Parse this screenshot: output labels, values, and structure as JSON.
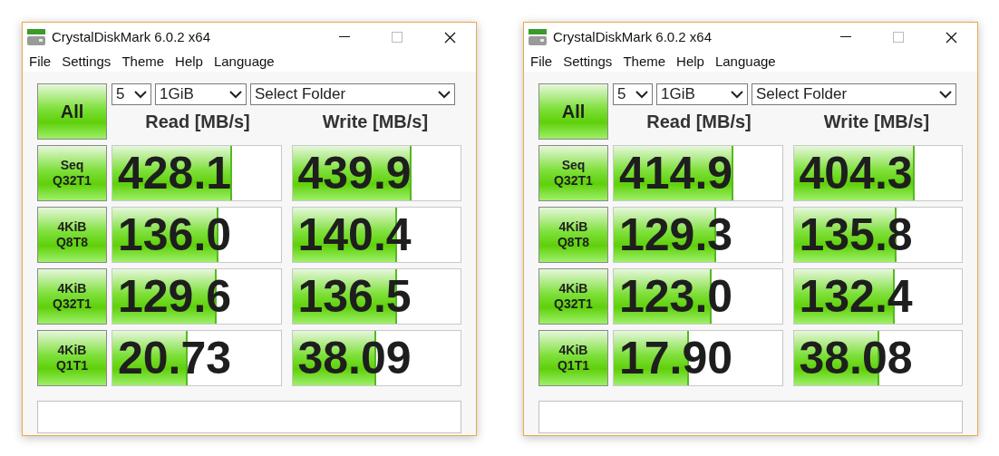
{
  "windows": [
    {
      "title": "CrystalDiskMark 6.0.2 x64",
      "menu": [
        "File",
        "Settings",
        "Theme",
        "Help",
        "Language"
      ],
      "all_button": "All",
      "count": "5",
      "size": "1GiB",
      "folder": "Select Folder",
      "read_header": "Read [MB/s]",
      "write_header": "Write [MB/s]",
      "rows": [
        {
          "test": [
            "Seq",
            "Q32T1"
          ],
          "read": {
            "value": "428.1",
            "level": 0.71
          },
          "write": {
            "value": "439.9",
            "level": 0.71
          }
        },
        {
          "test": [
            "4KiB",
            "Q8T8"
          ],
          "read": {
            "value": "136.0",
            "level": 0.63
          },
          "write": {
            "value": "140.4",
            "level": 0.62
          }
        },
        {
          "test": [
            "4KiB",
            "Q32T1"
          ],
          "read": {
            "value": "129.6",
            "level": 0.62
          },
          "write": {
            "value": "136.5",
            "level": 0.62
          }
        },
        {
          "test": [
            "4KiB",
            "Q1T1"
          ],
          "read": {
            "value": "20.73",
            "level": 0.45
          },
          "write": {
            "value": "38.09",
            "level": 0.5
          }
        }
      ]
    },
    {
      "title": "CrystalDiskMark 6.0.2 x64",
      "menu": [
        "File",
        "Settings",
        "Theme",
        "Help",
        "Language"
      ],
      "all_button": "All",
      "count": "5",
      "size": "1GiB",
      "folder": "Select Folder",
      "read_header": "Read [MB/s]",
      "write_header": "Write [MB/s]",
      "rows": [
        {
          "test": [
            "Seq",
            "Q32T1"
          ],
          "read": {
            "value": "414.9",
            "level": 0.71
          },
          "write": {
            "value": "404.3",
            "level": 0.72
          }
        },
        {
          "test": [
            "4KiB",
            "Q8T8"
          ],
          "read": {
            "value": "129.3",
            "level": 0.61
          },
          "write": {
            "value": "135.8",
            "level": 0.61
          }
        },
        {
          "test": [
            "4KiB",
            "Q32T1"
          ],
          "read": {
            "value": "123.0",
            "level": 0.58
          },
          "write": {
            "value": "132.4",
            "level": 0.6
          }
        },
        {
          "test": [
            "4KiB",
            "Q1T1"
          ],
          "read": {
            "value": "17.90",
            "level": 0.45
          },
          "write": {
            "value": "38.08",
            "level": 0.51
          }
        }
      ]
    }
  ]
}
